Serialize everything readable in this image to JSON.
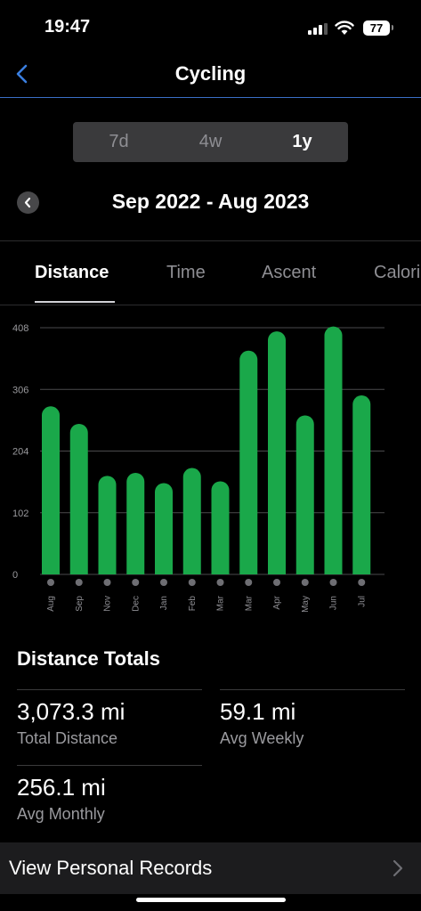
{
  "status": {
    "time": "19:47",
    "battery": "77"
  },
  "nav": {
    "title": "Cycling"
  },
  "ranges": [
    {
      "label": "7d",
      "active": false
    },
    {
      "label": "4w",
      "active": false
    },
    {
      "label": "1y",
      "active": true
    }
  ],
  "period": {
    "label": "Sep 2022 - Aug 2023"
  },
  "metric_tabs": [
    {
      "label": "Distance",
      "active": true
    },
    {
      "label": "Time",
      "active": false
    },
    {
      "label": "Ascent",
      "active": false
    },
    {
      "label": "Calories",
      "active": false
    }
  ],
  "chart_data": {
    "type": "bar",
    "categories": [
      "Aug",
      "Sep",
      "Nov",
      "Dec",
      "Jan",
      "Feb",
      "Mar",
      "Mar",
      "Apr",
      "May",
      "Jun",
      "Jul"
    ],
    "values": [
      278,
      249,
      163,
      168,
      151,
      176,
      154,
      370,
      402,
      263,
      410,
      296
    ],
    "yticks": [
      0,
      102,
      204,
      306,
      408
    ],
    "ylim": [
      0,
      408
    ],
    "bar_color": "#1aa84a",
    "grid": true
  },
  "totals": {
    "title": "Distance Totals",
    "total_distance": {
      "value": "3,073.3 mi",
      "label": "Total Distance"
    },
    "avg_weekly": {
      "value": "59.1 mi",
      "label": "Avg Weekly"
    },
    "avg_monthly": {
      "value": "256.1 mi",
      "label": "Avg Monthly"
    }
  },
  "records": {
    "label": "View Personal Records"
  },
  "colors": {
    "accent": "#3a6fc7",
    "bar": "#1aa84a",
    "background": "#000000"
  }
}
